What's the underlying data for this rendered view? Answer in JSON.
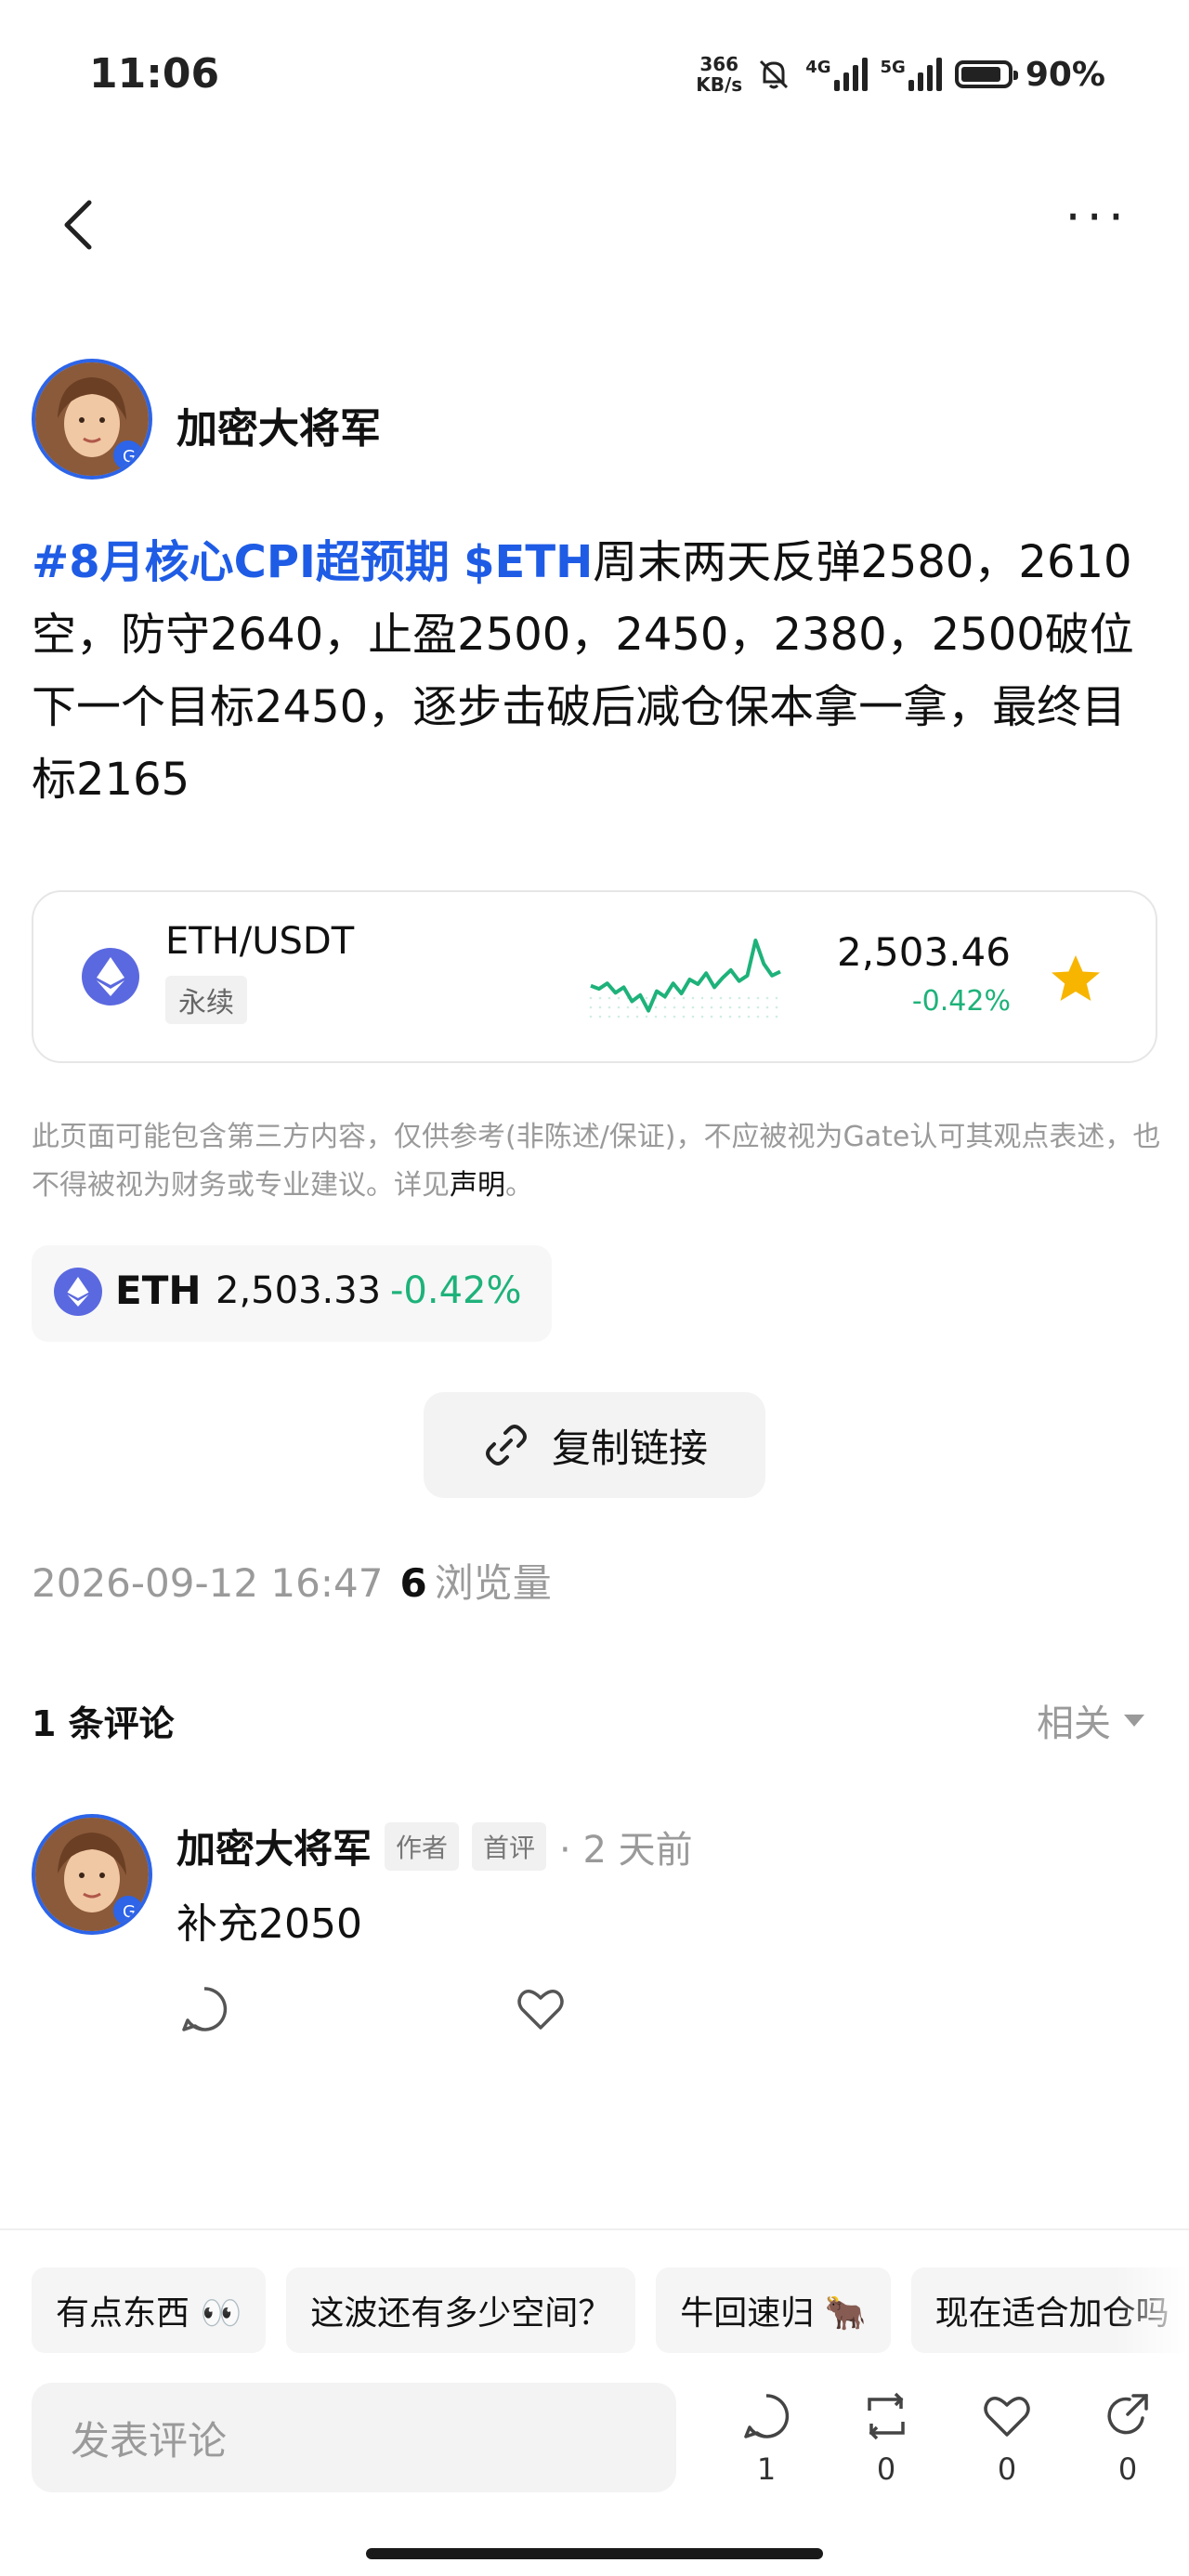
{
  "status": {
    "time": "11:06",
    "netspeed_value": "366",
    "netspeed_unit": "KB/s",
    "sig1": "4G",
    "sig2": "5G",
    "battery": "90%"
  },
  "author": {
    "name": "加密大将军"
  },
  "post": {
    "tag1": "#8月核心CPI超预期",
    "tag2": "$ETH",
    "text": "周末两天反弹2580，2610空，防守2640，止盈2500，2450，2380，2500破位下一个目标2450，逐步击破后减仓保本拿一拿，最终目标2165"
  },
  "pair_card": {
    "pair": "ETH/USDT",
    "type": "永续",
    "price": "2,503.46",
    "change": "-0.42%",
    "chart_data": {
      "type": "line",
      "values": [
        0.42,
        0.38,
        0.45,
        0.33,
        0.4,
        0.22,
        0.3,
        0.1,
        0.35,
        0.28,
        0.45,
        0.32,
        0.5,
        0.44,
        0.58,
        0.4,
        0.52,
        0.62,
        0.48,
        0.55,
        1.0,
        0.7,
        0.55,
        0.6
      ],
      "color": "#1eb27a"
    }
  },
  "disclaimer": {
    "text": "此页面可能包含第三方内容，仅供参考(非陈述/保证)，不应被视为Gate认可其观点表述，也不得被视为财务或专业建议。详见",
    "link": "声明",
    "end": "。"
  },
  "ticker": {
    "symbol": "ETH",
    "price": "2,503.33",
    "change": "-0.42%"
  },
  "copy_link": {
    "label": "复制链接"
  },
  "meta": {
    "datetime": "2026-09-12 16:47",
    "views": "6",
    "views_label": "浏览量"
  },
  "comments": {
    "count_label": "1 条评论",
    "sort_label": "相关",
    "items": [
      {
        "name": "加密大将军",
        "badge1": "作者",
        "badge2": "首评",
        "time": "· 2 天前",
        "body": "补充2050"
      }
    ]
  },
  "quick_replies": [
    "有点东西 👀",
    "这波还有多少空间？",
    "牛回速归 🐂",
    "现在适合加仓吗"
  ],
  "composer": {
    "placeholder": "发表评论",
    "comment_count": "1",
    "repost_count": "0",
    "like_count": "0",
    "share_count": "0"
  },
  "colors": {
    "accent": "#1f5ce5",
    "up_green": "#1eb27a",
    "star": "#f7b500"
  }
}
